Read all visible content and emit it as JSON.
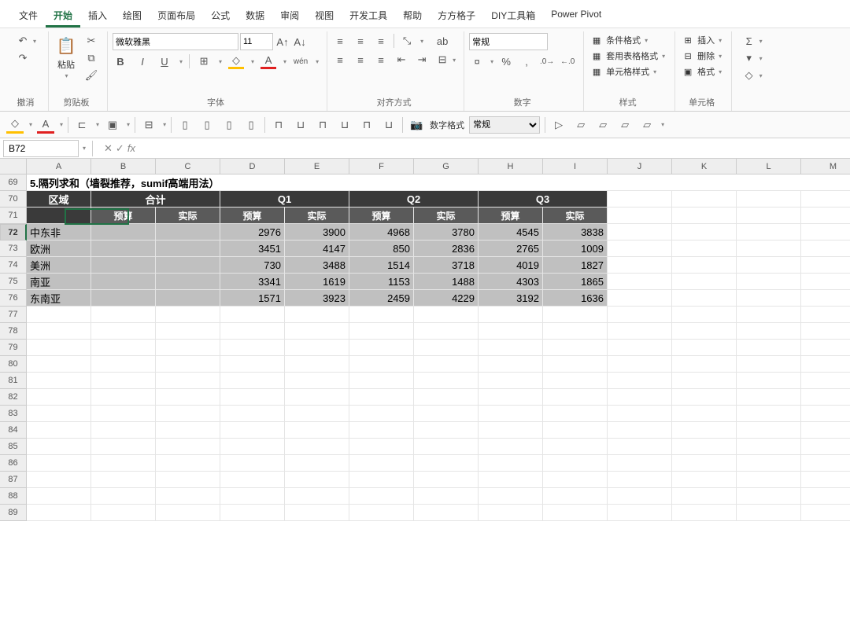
{
  "menu": {
    "tabs": [
      "文件",
      "开始",
      "插入",
      "绘图",
      "页面布局",
      "公式",
      "数据",
      "审阅",
      "视图",
      "开发工具",
      "帮助",
      "方方格子",
      "DIY工具箱",
      "Power Pivot"
    ],
    "active": 1
  },
  "ribbon": {
    "undo": {
      "label": "撤消"
    },
    "clipboard": {
      "paste": "粘贴",
      "label": "剪贴板"
    },
    "font": {
      "name": "微软雅黑",
      "size": "11",
      "bold": "B",
      "italic": "I",
      "underline": "U",
      "label": "字体"
    },
    "alignment": {
      "wrap": "ab",
      "label": "对齐方式"
    },
    "number": {
      "format": "常规",
      "label": "数字"
    },
    "styles": {
      "conditional": "条件格式",
      "table_format": "套用表格格式",
      "cell_styles": "单元格样式",
      "label": "样式"
    },
    "cells": {
      "insert": "插入",
      "delete": "删除",
      "format": "格式",
      "label": "单元格"
    }
  },
  "qat": {
    "number_format_label": "数字格式",
    "number_format": "常规"
  },
  "formula": {
    "name_box": "B72",
    "value": ""
  },
  "columns": [
    "A",
    "B",
    "C",
    "D",
    "E",
    "F",
    "G",
    "H",
    "I",
    "J",
    "K",
    "L",
    "M"
  ],
  "row_start": 69,
  "row_end": 89,
  "active_row": 72,
  "table": {
    "title": "5.隔列求和（墙裂推荐，sumif高端用法）",
    "h1": [
      "区域",
      "合计",
      "",
      "Q1",
      "",
      "Q2",
      "",
      "Q3",
      ""
    ],
    "h1_span": [
      1,
      2,
      0,
      2,
      0,
      2,
      0,
      2,
      0
    ],
    "h2": [
      "",
      "预算",
      "实际",
      "预算",
      "实际",
      "预算",
      "实际",
      "预算",
      "实际"
    ],
    "rows": [
      {
        "region": "中东非",
        "b": "",
        "c": "",
        "vals": [
          "2976",
          "3900",
          "4968",
          "3780",
          "4545",
          "3838"
        ]
      },
      {
        "region": "欧洲",
        "b": "",
        "c": "",
        "vals": [
          "3451",
          "4147",
          "850",
          "2836",
          "2765",
          "1009"
        ]
      },
      {
        "region": "美洲",
        "b": "",
        "c": "",
        "vals": [
          "730",
          "3488",
          "1514",
          "3718",
          "4019",
          "1827"
        ]
      },
      {
        "region": "南亚",
        "b": "",
        "c": "",
        "vals": [
          "3341",
          "1619",
          "1153",
          "1488",
          "4303",
          "1865"
        ]
      },
      {
        "region": "东南亚",
        "b": "",
        "c": "",
        "vals": [
          "1571",
          "3923",
          "2459",
          "4229",
          "3192",
          "1636"
        ]
      }
    ]
  }
}
